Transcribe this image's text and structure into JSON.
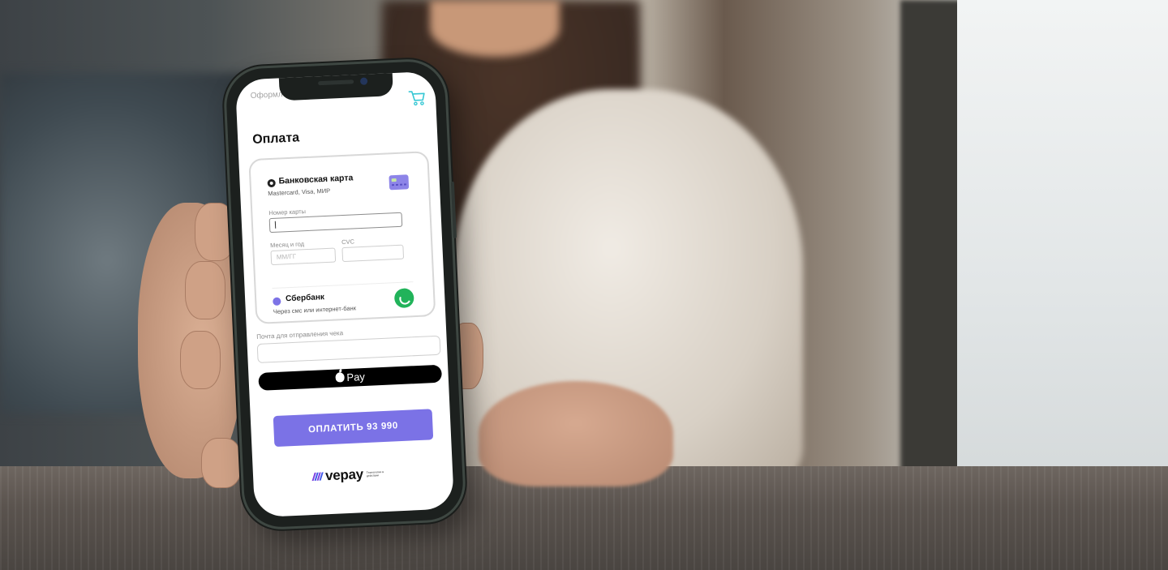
{
  "checkout": {
    "breadcrumb": "Оформление заказа/ оплата",
    "title": "Оплата",
    "bank_card": {
      "name": "Банковская карта",
      "subtitle": "Mastercard, Visa, МИР",
      "card_number_label": "Номер карты",
      "expiry_label": "Месяц и год",
      "expiry_placeholder": "ММ/ГГ",
      "cvc_label": "CVC"
    },
    "sberbank": {
      "name": "Сбербанк",
      "subtitle": "Через смс или интернет-банк"
    },
    "email_label": "Почта для отправления чека",
    "apple_pay_label": "Pay",
    "pay_button": "ОПЛАТИТЬ 93 990",
    "brand": {
      "name": "vepay",
      "tagline": "Технологии в действии"
    }
  },
  "colors": {
    "accent": "#7b72e6",
    "sber_green": "#21b35a",
    "cart_cyan": "#35c7d4"
  },
  "icons": [
    "cart-icon",
    "card-icon",
    "sberbank-logo-icon",
    "apple-logo-icon"
  ]
}
